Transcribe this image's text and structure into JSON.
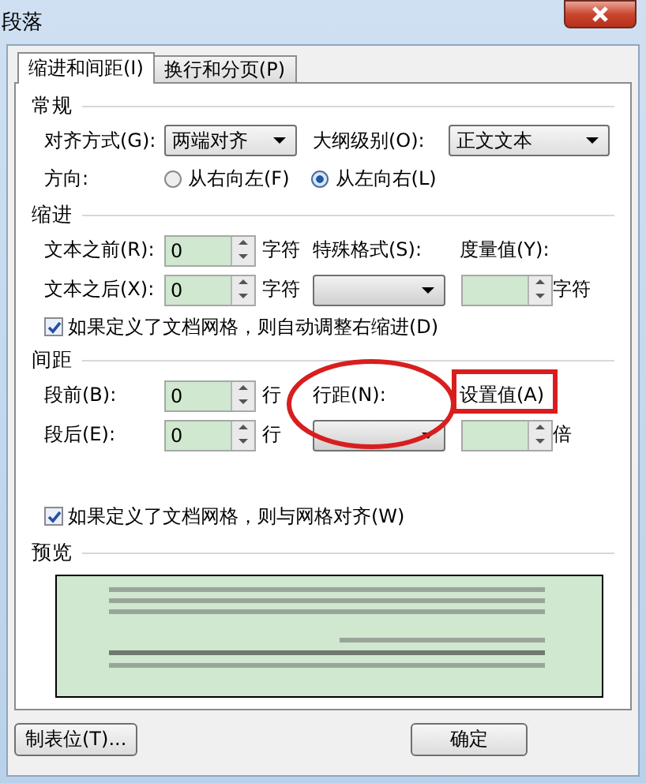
{
  "window": {
    "title": "段落"
  },
  "tabs": [
    {
      "label": "缩进和间距(I)",
      "selected": true
    },
    {
      "label": "换行和分页(P)",
      "selected": false
    }
  ],
  "general": {
    "heading": "常规",
    "alignment": {
      "label": "对齐方式(G):",
      "value": "两端对齐"
    },
    "outline_level": {
      "label": "大纲级别(O):",
      "value": "正文文本"
    },
    "direction": {
      "label": "方向:",
      "options": [
        {
          "label": "从右向左(F)",
          "selected": false
        },
        {
          "label": "从左向右(L)",
          "selected": true
        }
      ]
    }
  },
  "indent": {
    "heading": "缩进",
    "before": {
      "label": "文本之前(R):",
      "value": "0",
      "unit": "字符"
    },
    "after": {
      "label": "文本之后(X):",
      "value": "0",
      "unit": "字符"
    },
    "special": {
      "label": "特殊格式(S):"
    },
    "measure": {
      "label": "度量值(Y):",
      "unit": "字符"
    },
    "auto_adjust": {
      "label": "如果定义了文档网格，则自动调整右缩进(D)",
      "checked": true
    }
  },
  "spacing": {
    "heading": "间距",
    "before": {
      "label": "段前(B):",
      "value": "0",
      "unit": "行"
    },
    "after": {
      "label": "段后(E):",
      "value": "0",
      "unit": "行"
    },
    "line_spacing": {
      "label": "行距(N):"
    },
    "at": {
      "label": "设置值(A)",
      "unit": "倍"
    },
    "snap_to_grid": {
      "label": "如果定义了文档网格，则与网格对齐(W)",
      "checked": true
    }
  },
  "preview": {
    "heading": "预览"
  },
  "buttons": [
    {
      "label": "制表位(T)..."
    },
    {
      "label": "确定"
    }
  ]
}
